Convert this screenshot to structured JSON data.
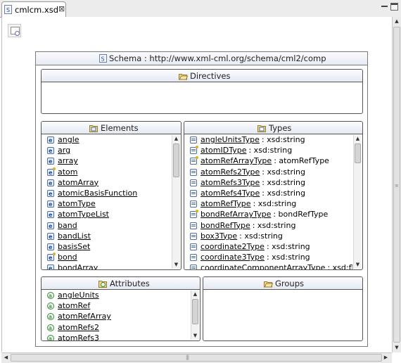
{
  "tab": {
    "icon": "xsd-file-icon",
    "title": "cmlcm.xsd",
    "close": "⊠"
  },
  "schema": {
    "title": "Schema : http://www.xml-cml.org/schema/cml2/comp"
  },
  "panels": {
    "directives": {
      "title": "Directives"
    },
    "elements": {
      "title": "Elements",
      "items": [
        {
          "name": "angle",
          "complex": false
        },
        {
          "name": "arg",
          "complex": false
        },
        {
          "name": "array",
          "complex": false
        },
        {
          "name": "atom",
          "complex": true
        },
        {
          "name": "atomArray",
          "complex": false
        },
        {
          "name": "atomicBasisFunction",
          "complex": false
        },
        {
          "name": "atomType",
          "complex": false
        },
        {
          "name": "atomTypeList",
          "complex": false
        },
        {
          "name": "band",
          "complex": false
        },
        {
          "name": "bandList",
          "complex": false
        },
        {
          "name": "basisSet",
          "complex": false
        },
        {
          "name": "bond",
          "complex": true
        },
        {
          "name": "bondArray",
          "complex": false
        }
      ]
    },
    "types": {
      "title": "Types",
      "items": [
        {
          "name": "angleUnitsType",
          "type": ": xsd:string",
          "complex": false
        },
        {
          "name": "atomIDType",
          "type": ": xsd:string",
          "complex": true
        },
        {
          "name": "atomRefArrayType",
          "type": ": atomRefType",
          "complex": true
        },
        {
          "name": "atomRefs2Type",
          "type": ": xsd:string",
          "complex": false
        },
        {
          "name": "atomRefs3Type",
          "type": ": xsd:string",
          "complex": false
        },
        {
          "name": "atomRefs4Type",
          "type": ": xsd:string",
          "complex": false
        },
        {
          "name": "atomRefType",
          "type": ": xsd:string",
          "complex": false
        },
        {
          "name": "bondRefArrayType",
          "type": ": bondRefType",
          "complex": true
        },
        {
          "name": "bondRefType",
          "type": ": xsd:string",
          "complex": false
        },
        {
          "name": "box3Type",
          "type": ": xsd:string",
          "complex": false
        },
        {
          "name": "coordinate2Type",
          "type": ": xsd:string",
          "complex": false
        },
        {
          "name": "coordinate3Type",
          "type": ": xsd:string",
          "complex": false
        },
        {
          "name": "coordinateComponentArrayType",
          "type": ": xsd:fl",
          "complex": false
        }
      ]
    },
    "attributes": {
      "title": "Attributes",
      "items": [
        {
          "name": "angleUnits"
        },
        {
          "name": "atomRef"
        },
        {
          "name": "atomRefArray"
        },
        {
          "name": "atomRefs2"
        },
        {
          "name": "atomRefs3"
        }
      ]
    },
    "groups": {
      "title": "Groups"
    }
  },
  "scroll": {
    "elements_position": 0.0,
    "types_position": 0.0,
    "attributes_position": 0.0
  },
  "colors": {
    "panel_header_top": "#fbfcfe",
    "panel_header_bottom": "#e4e9f2",
    "panel_border": "#555555",
    "element_icon": "#1e4a9a"
  }
}
